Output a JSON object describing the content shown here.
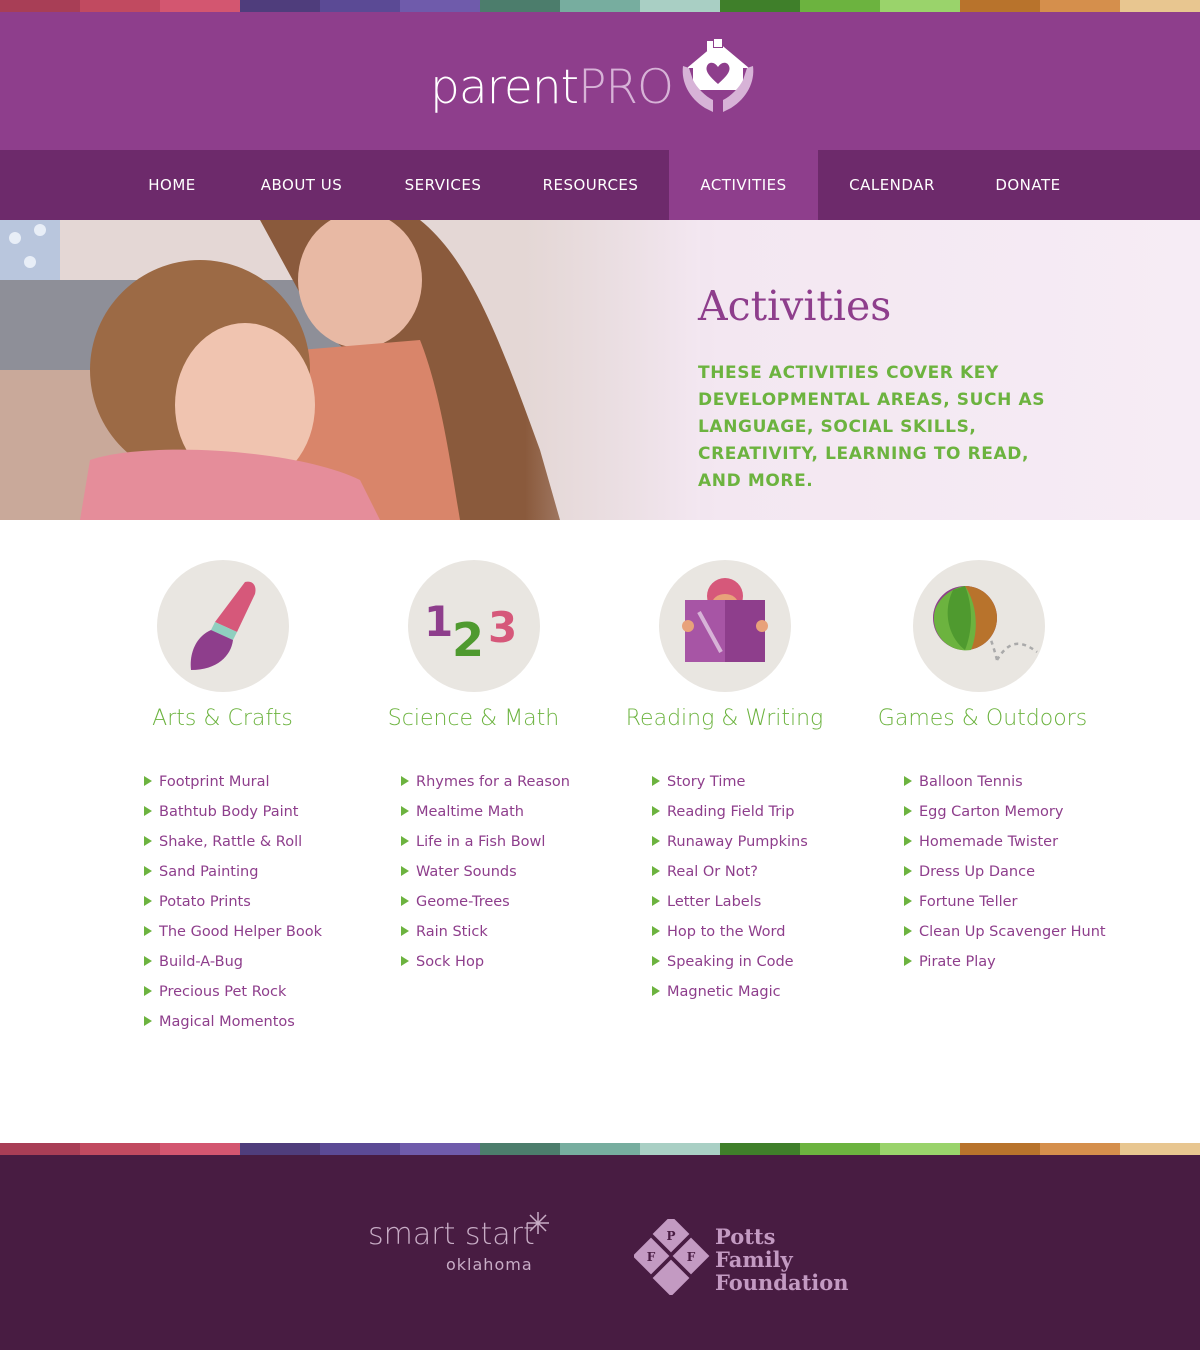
{
  "colors": {
    "brand_purple": "#8e3e8c",
    "nav_purple": "#6d2a6b",
    "accent_green": "#6cb33f",
    "footer_purple": "#481c42",
    "stripe": [
      "#a83e56",
      "#c14a60",
      "#d35670",
      "#4f3d7c",
      "#5b4a95",
      "#6f5bab",
      "#4c7d6c",
      "#77ad9f",
      "#a9cfc4",
      "#3f7f2a",
      "#6cb33f",
      "#9ad36b",
      "#b8732c",
      "#d58f4c",
      "#e8c690"
    ]
  },
  "header": {
    "logo_text_1": "parent",
    "logo_text_2": "PRO",
    "logo_icon": "house-heart-hands-icon"
  },
  "nav": {
    "items": [
      {
        "label": "HOME"
      },
      {
        "label": "ABOUT US"
      },
      {
        "label": "SERVICES"
      },
      {
        "label": "RESOURCES"
      },
      {
        "label": "ACTIVITIES",
        "active": true
      },
      {
        "label": "CALENDAR"
      },
      {
        "label": "DONATE"
      }
    ]
  },
  "hero": {
    "title": "Activities",
    "subtitle": "THESE ACTIVITIES COVER KEY DEVELOPMENTAL AREAS, SUCH AS LANGUAGE, SOCIAL SKILLS, CREATIVITY, LEARNING TO READ, AND MORE.",
    "image": "mother-and-daughter-photo"
  },
  "categories": [
    {
      "title": "Arts & Crafts",
      "icon": "paintbrush-icon",
      "items": [
        "Footprint Mural",
        "Bathtub Body Paint",
        "Shake, Rattle & Roll",
        "Sand Painting",
        "Potato Prints",
        "The Good Helper Book",
        "Build-A-Bug",
        "Precious Pet Rock",
        "Magical Momentos"
      ]
    },
    {
      "title": "Science & Math",
      "icon": "numbers-123-icon",
      "items": [
        "Rhymes for a Reason",
        "Mealtime Math",
        "Life in a Fish Bowl",
        "Water Sounds",
        "Geome-Trees",
        "Rain Stick",
        "Sock Hop"
      ]
    },
    {
      "title": "Reading & Writing",
      "icon": "child-reading-book-icon",
      "items": [
        "Story Time",
        "Reading Field Trip",
        "Runaway Pumpkins",
        "Real Or Not?",
        "Letter Labels",
        "Hop to the Word",
        "Speaking in Code",
        "Magnetic Magic"
      ]
    },
    {
      "title": "Games & Outdoors",
      "icon": "bouncing-ball-icon",
      "items": [
        "Balloon Tennis",
        "Egg Carton Memory",
        "Homemade Twister",
        "Dress Up Dance",
        "Fortune Teller",
        "Clean Up Scavenger Hunt",
        "Pirate Play"
      ]
    }
  ],
  "footer": {
    "smart_start": {
      "main": "smart start",
      "sub": "oklahoma"
    },
    "potts": {
      "line1": "Potts",
      "line2": "Family",
      "line3": "Foundation",
      "monogram": [
        "P",
        "F",
        "F"
      ]
    }
  }
}
